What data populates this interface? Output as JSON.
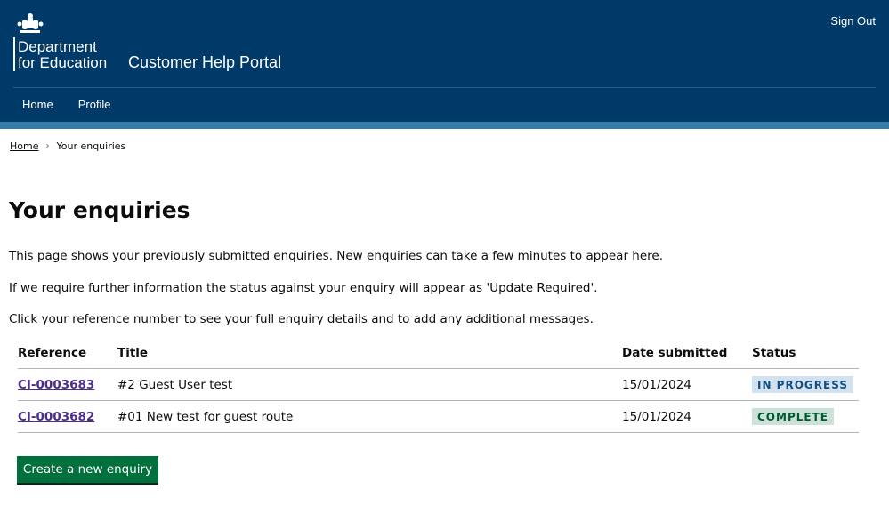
{
  "header": {
    "crest_icon": "royal-crest-icon",
    "org_line1": "Department",
    "org_line2": "for Education",
    "service_name": "Customer Help Portal",
    "sign_out": "Sign Out",
    "nav": [
      {
        "label": "Home"
      },
      {
        "label": "Profile"
      }
    ]
  },
  "breadcrumb": {
    "home": "Home",
    "current": "Your enquiries"
  },
  "page": {
    "title": "Your enquiries",
    "paragraphs": [
      "This page shows your previously submitted enquiries. New enquiries can take a few minutes to appear here.",
      "If we require further information the status against your enquiry will appear as 'Update Required'.",
      "Click your reference number to see your full enquiry details and to add any additional messages."
    ]
  },
  "table": {
    "headers": [
      "Reference",
      "Title",
      "Date submitted",
      "Status"
    ],
    "rows": [
      {
        "reference": "CI-0003683",
        "title": "#2 Guest User test",
        "date": "15/01/2024",
        "status": "IN PROGRESS"
      },
      {
        "reference": "CI-0003682",
        "title": "#01 New test for guest route",
        "date": "15/01/2024",
        "status": "COMPLETE"
      }
    ]
  },
  "button": {
    "label": "Create a new enquiry"
  },
  "colors": {
    "header_bg": "#003a69",
    "header_band": "#347ca9",
    "button_bg": "#00703c",
    "link": "#4c2c92",
    "tag_progress_bg": "#d2e2f1",
    "tag_complete_bg": "#cce2d8"
  }
}
